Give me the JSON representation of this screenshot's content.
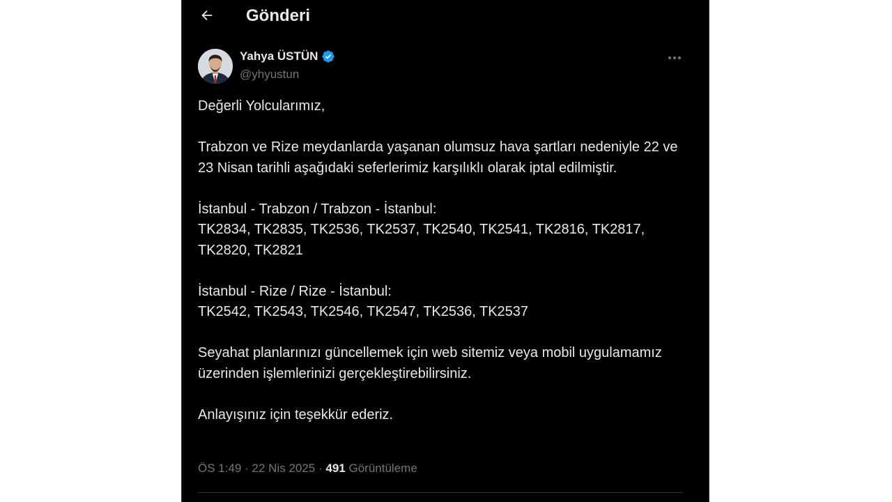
{
  "header": {
    "title": "Gönderi"
  },
  "author": {
    "name": "Yahya ÜSTÜN",
    "handle": "@yhyustun"
  },
  "tweet": {
    "greeting": "Değerli Yolcularımız,",
    "intro": "Trabzon ve Rize meydanlarda yaşanan olumsuz hava şartları nedeniyle 22 ve 23 Nisan tarihli aşağıdaki seferlerimiz karşılıklı olarak iptal edilmiştir.",
    "trabzon_heading": "İstanbul - Trabzon / Trabzon - İstanbul:",
    "trabzon_flights": "TK2834, TK2835, TK2536, TK2537, TK2540, TK2541, TK2816, TK2817, TK2820, TK2821",
    "rize_heading": "İstanbul - Rize / Rize - İstanbul:",
    "rize_flights": "TK2542, TK2543, TK2546, TK2547, TK2536, TK2537",
    "update_note": "Seyahat planlarınızı güncellemek için web sitemiz veya mobil uygulamamız üzerinden işlemlerinizi gerçekleştirebilirsiniz.",
    "thanks": "Anlayışınız için teşekkür ederiz."
  },
  "meta": {
    "time": "ÖS 1:49",
    "separator": "·",
    "date": "22 Nis 2025",
    "views_count": "491",
    "views_label": "Görüntüleme"
  },
  "colors": {
    "background": "#000000",
    "text": "#e7e9ea",
    "muted": "#71767b",
    "verified": "#1d9bf0"
  },
  "icons": {
    "back": "arrow-left-icon",
    "verified": "verified-badge-icon",
    "more": "more-horizontal-icon"
  }
}
